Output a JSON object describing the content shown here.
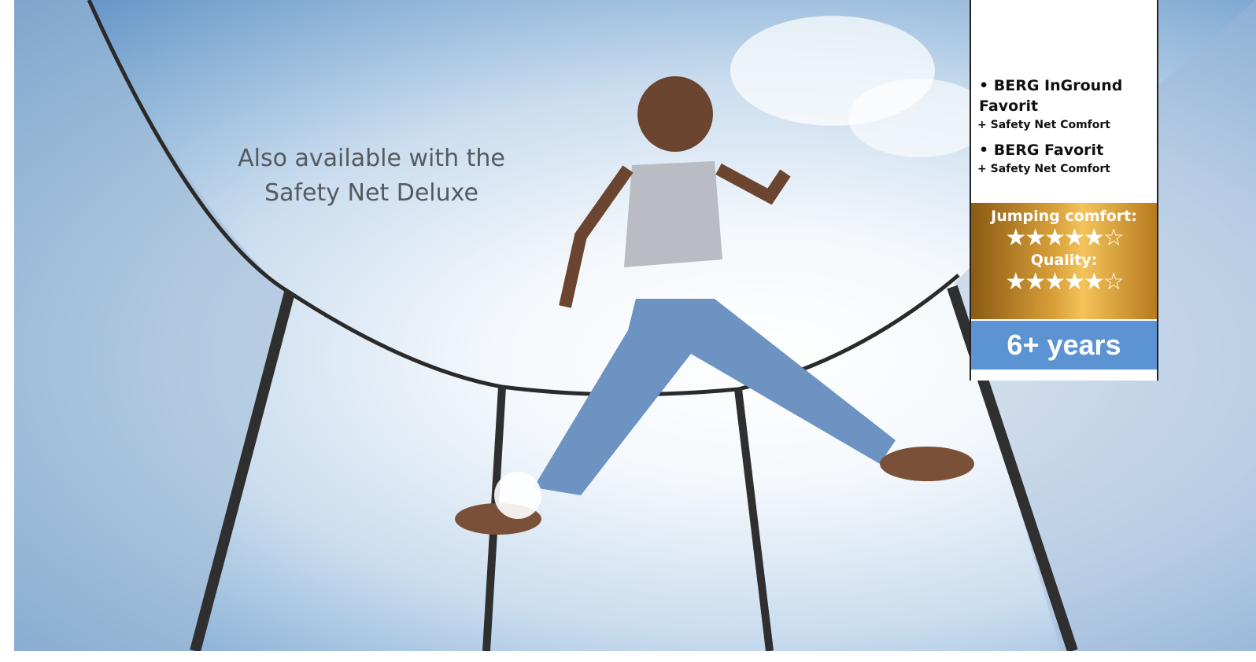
{
  "caption": {
    "line1": "Also available with the",
    "line2": "Safety Net  Deluxe"
  },
  "product_panel": {
    "items": [
      {
        "name": "• BERG InGround Favorit",
        "sub": "+ Safety Net Comfort"
      },
      {
        "name": "• BERG  Favorit",
        "sub": "+ Safety Net Comfort"
      }
    ],
    "jumping_label": "Jumping comfort:",
    "jumping_stars": "★★★★★☆",
    "quality_label": "Quality:",
    "quality_stars": "★★★★★☆",
    "age": "6+ years"
  },
  "colors": {
    "age_band": "#5b93d3",
    "rating_band": "#d9a03a"
  }
}
